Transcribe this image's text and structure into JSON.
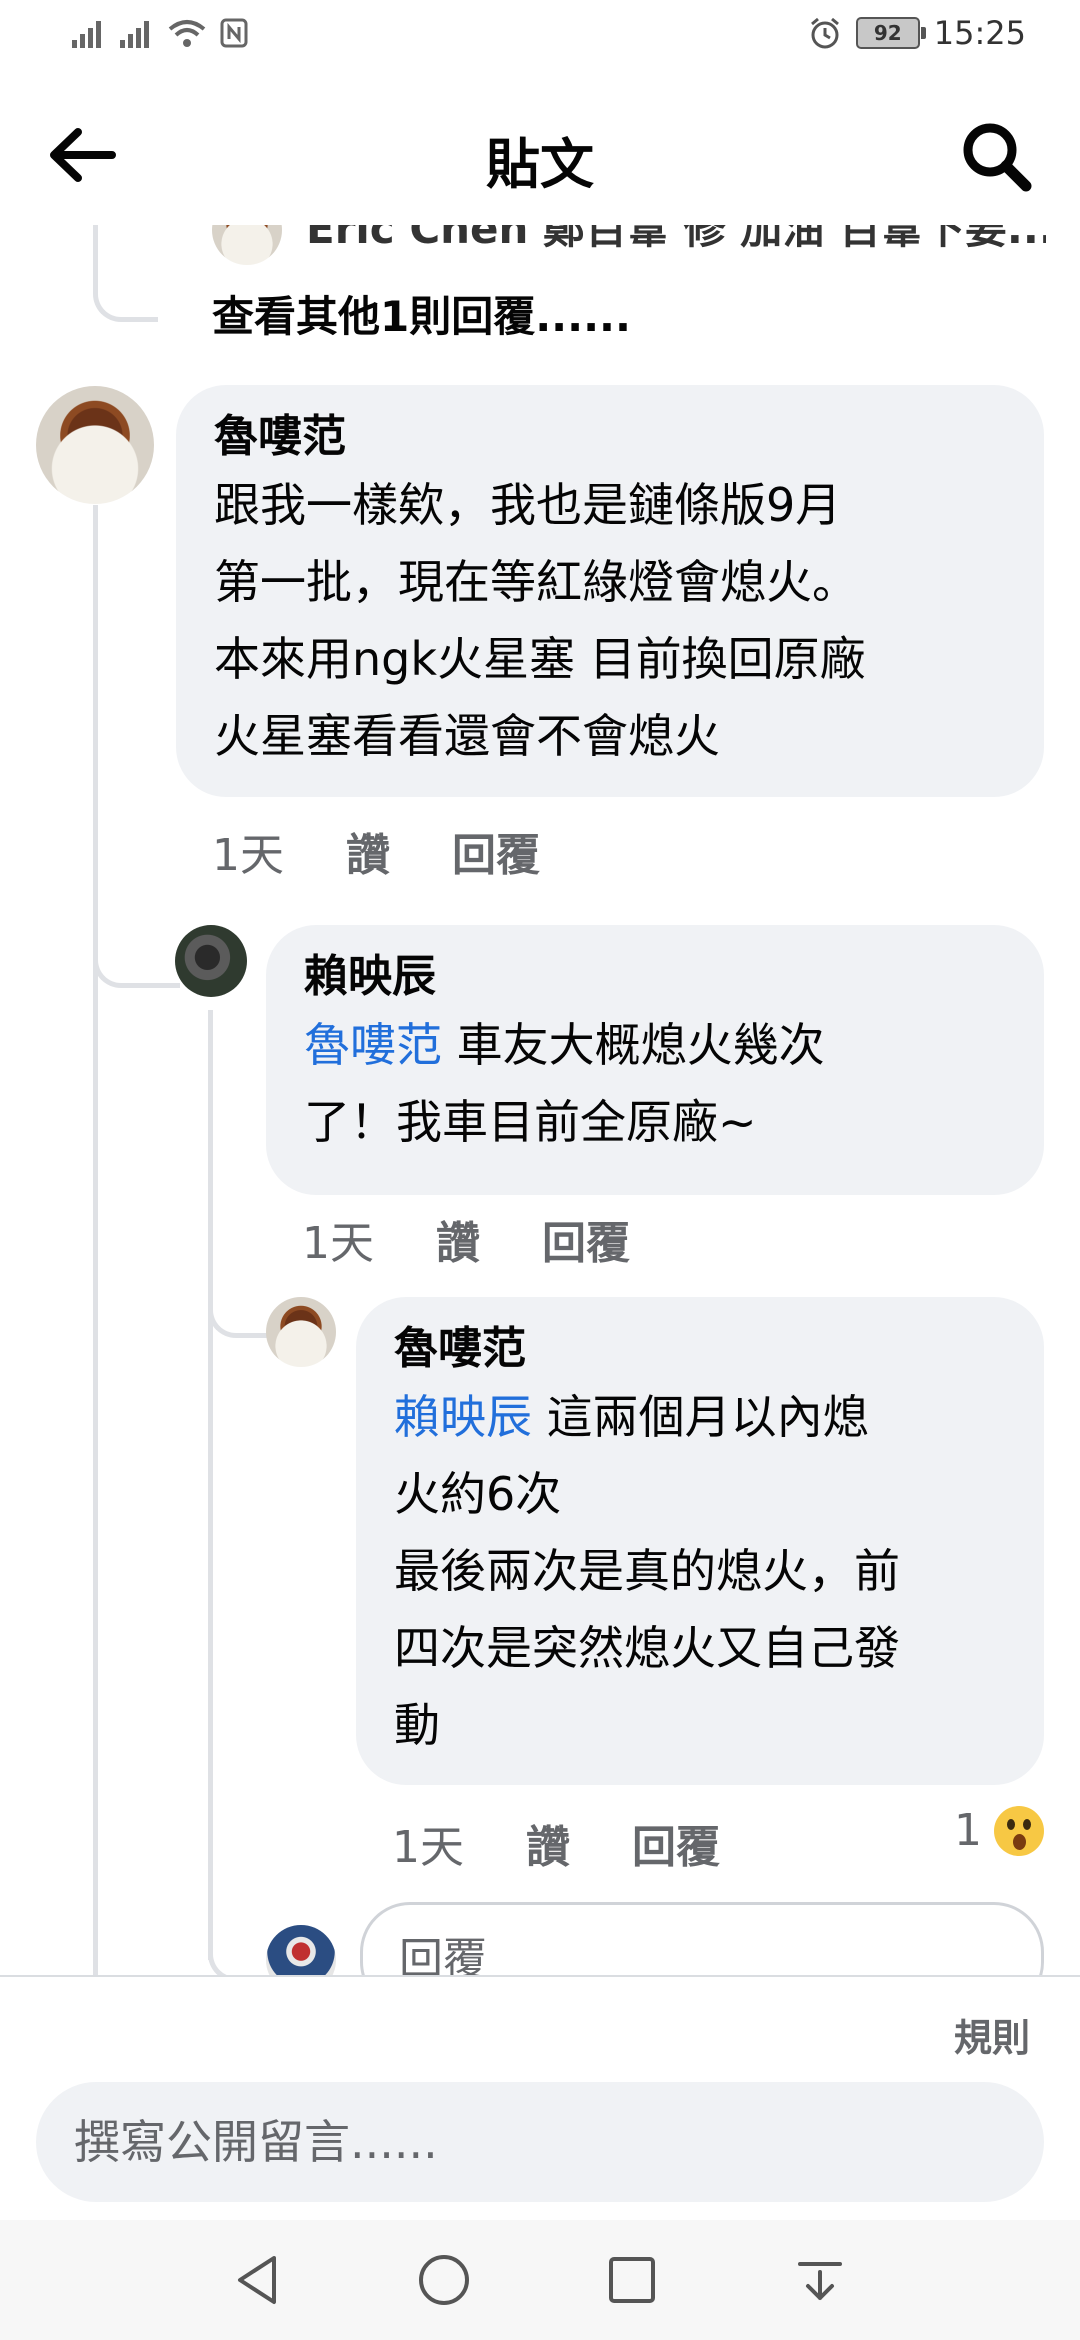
{
  "status_bar": {
    "time": "15:25",
    "battery": "92"
  },
  "header": {
    "title": "貼文"
  },
  "thread": {
    "partial_comment": "Eric Chen 鄭百葦 修 加油 百葦下要...",
    "view_more": "查看其他1則回覆......",
    "comments": [
      {
        "author": "魯嘍范",
        "mention": "",
        "text": "跟我一樣欸，我也是鏈條版9月\n第一批，現在等紅綠燈會熄火。\n本來用ngk火星塞 目前換回原廠\n火星塞看看還會不會熄火",
        "time": "1天",
        "like": "讚",
        "reply": "回覆"
      },
      {
        "author": "賴映辰",
        "mention": "魯嘍范",
        "text": " 車友大概熄火幾次\n了！我車目前全原廠~",
        "time": "1天",
        "like": "讚",
        "reply": "回覆"
      },
      {
        "author": "魯嘍范",
        "mention": "賴映辰",
        "text": " 這兩個月以內熄\n火約6次\n最後兩次是真的熄火，前\n四次是突然熄火又自己發\n動",
        "time": "1天",
        "like": "讚",
        "reply": "回覆",
        "reaction_count": "1"
      }
    ],
    "reply_placeholder": "回覆"
  },
  "composer": {
    "rules": "規則",
    "placeholder": "撰寫公開留言......"
  },
  "icons": {
    "back": "back-arrow-icon",
    "search": "search-icon",
    "reaction": "wow-emoji-icon"
  }
}
